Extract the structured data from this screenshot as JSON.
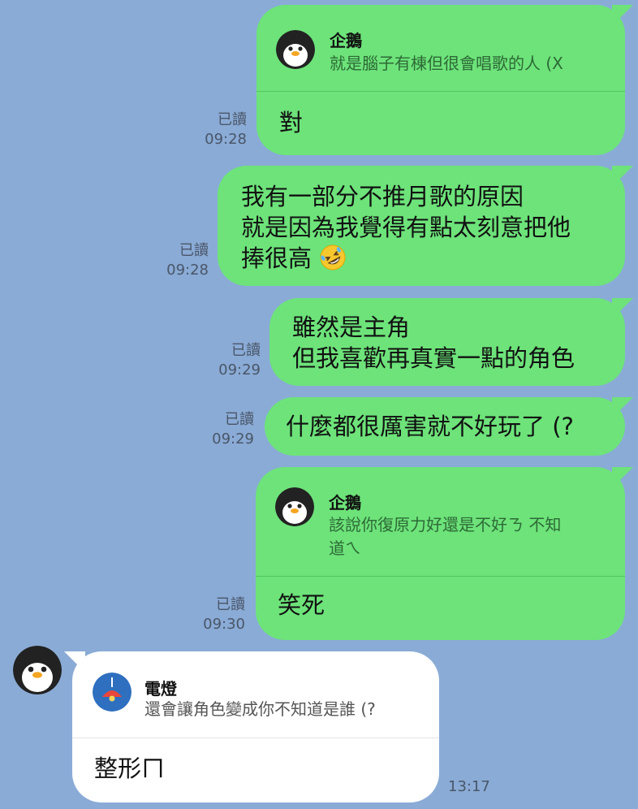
{
  "messages": [
    {
      "quote": {
        "name": "企鵝",
        "lines": [
          "就是腦子有棟但很會唱歌的人 (X"
        ]
      },
      "lines": [
        "對"
      ],
      "read": "已讀",
      "time": "09:28"
    },
    {
      "lines": [
        "我有一部分不推月歌的原因",
        "就是因為我覺得有點太刻意把他",
        "捧很高"
      ],
      "read": "已讀",
      "time": "09:28",
      "emoji": "rolling-on-floor-laughing-emoji"
    },
    {
      "lines": [
        "雖然是主角",
        "但我喜歡再真實一點的角色"
      ],
      "read": "已讀",
      "time": "09:29"
    },
    {
      "lines": [
        "什麼都很厲害就不好玩了 (?"
      ],
      "read": "已讀",
      "time": "09:29"
    },
    {
      "quote": {
        "name": "企鵝",
        "lines": [
          "該說你復原力好還是不好ㄋ 不知",
          "道ㄟ"
        ]
      },
      "lines": [
        "笑死"
      ],
      "read": "已讀",
      "time": "09:30"
    },
    {
      "quote": {
        "name": "電燈",
        "lines": [
          "還會讓角色變成你不知道是誰 (?"
        ]
      },
      "lines": [
        "整形ㄇ"
      ],
      "time": "13:17"
    }
  ],
  "colors": {
    "background": "#8aabd6",
    "outgoing_bubble": "#6de37a",
    "incoming_bubble": "#ffffff",
    "lamp_avatar": "#2e6fc0"
  }
}
